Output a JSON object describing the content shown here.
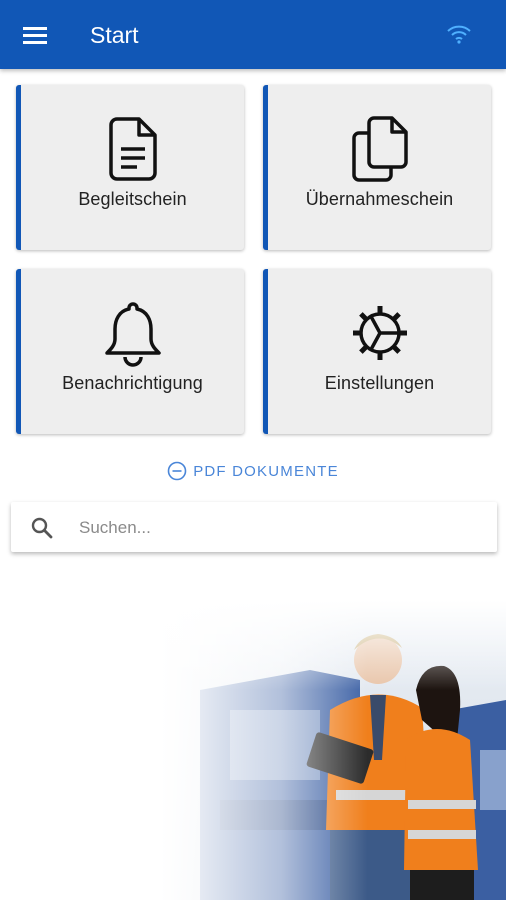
{
  "appbar": {
    "title": "Start",
    "menu_icon": "menu-icon",
    "status_icon": "wifi-icon",
    "background": "#1157b6"
  },
  "tiles": [
    {
      "label": "Begleitschein",
      "icon": "document-icon"
    },
    {
      "label": "Übernahmeschein",
      "icon": "documents-copy-icon"
    },
    {
      "label": "Benachrichtigung",
      "icon": "bell-icon"
    },
    {
      "label": "Einstellungen",
      "icon": "gear-icon"
    }
  ],
  "pdf_link": {
    "label": "PDF DOKUMENTE",
    "icon": "minus-circle-icon",
    "color": "#4a86d8"
  },
  "search": {
    "placeholder": "Suchen...",
    "value": "",
    "icon": "search-icon"
  },
  "hero_image": {
    "icon": "workers-photo"
  }
}
